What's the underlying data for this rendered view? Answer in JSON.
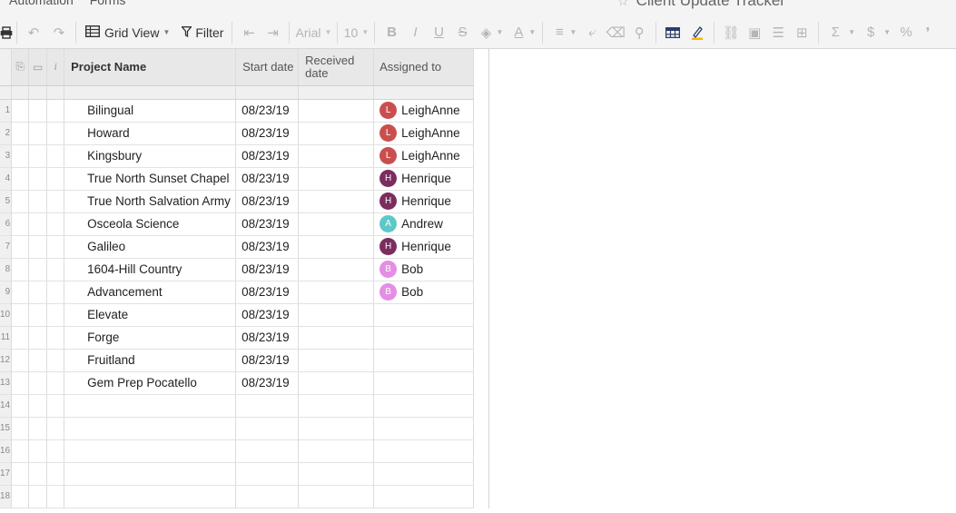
{
  "menu": {
    "items": [
      "Automation",
      "Forms"
    ]
  },
  "document": {
    "title": "Client Update Tracker"
  },
  "toolbar": {
    "view_label": "Grid View",
    "filter_label": "Filter",
    "font_family": "Arial",
    "font_size": "10",
    "colors": {
      "highlight_accent": "#f5b700",
      "text_color_underline": "#cccccc"
    }
  },
  "sheet": {
    "columns": {
      "project_name": "Project Name",
      "start_date": "Start date",
      "received_date": "Received date",
      "assigned_to": "Assigned to"
    },
    "row_numbers": [
      "1",
      "2",
      "3",
      "4",
      "5",
      "6",
      "7",
      "8",
      "9",
      "10",
      "11",
      "12",
      "13",
      "14",
      "15",
      "16",
      "17",
      "18"
    ],
    "rows": [
      {
        "name": "Bilingual",
        "start": "08/23/19",
        "received": "",
        "assignee": "LeighAnne",
        "initial": "L",
        "color": "#c94f4f"
      },
      {
        "name": "Howard",
        "start": "08/23/19",
        "received": "",
        "assignee": "LeighAnne",
        "initial": "L",
        "color": "#c94f4f"
      },
      {
        "name": "Kingsbury",
        "start": "08/23/19",
        "received": "",
        "assignee": "LeighAnne",
        "initial": "L",
        "color": "#c94f4f"
      },
      {
        "name": "True North Sunset Chapel",
        "start": "08/23/19",
        "received": "",
        "assignee": "Henrique",
        "initial": "H",
        "color": "#7b2d5e"
      },
      {
        "name": "True North Salvation Army",
        "start": "08/23/19",
        "received": "",
        "assignee": "Henrique",
        "initial": "H",
        "color": "#7b2d5e"
      },
      {
        "name": "Osceola Science",
        "start": "08/23/19",
        "received": "",
        "assignee": "Andrew",
        "initial": "A",
        "color": "#5ec8c8"
      },
      {
        "name": "Galileo",
        "start": "08/23/19",
        "received": "",
        "assignee": "Henrique",
        "initial": "H",
        "color": "#7b2d5e"
      },
      {
        "name": "1604-Hill Country",
        "start": "08/23/19",
        "received": "",
        "assignee": "Bob",
        "initial": "B",
        "color": "#e48ee4"
      },
      {
        "name": "Advancement",
        "start": "08/23/19",
        "received": "",
        "assignee": "Bob",
        "initial": "B",
        "color": "#e48ee4"
      },
      {
        "name": "Elevate",
        "start": "08/23/19",
        "received": "",
        "assignee": "",
        "initial": "",
        "color": ""
      },
      {
        "name": "Forge",
        "start": "08/23/19",
        "received": "",
        "assignee": "",
        "initial": "",
        "color": ""
      },
      {
        "name": "Fruitland",
        "start": "08/23/19",
        "received": "",
        "assignee": "",
        "initial": "",
        "color": ""
      },
      {
        "name": "Gem Prep Pocatello",
        "start": "08/23/19",
        "received": "",
        "assignee": "",
        "initial": "",
        "color": ""
      },
      {
        "name": "",
        "start": "",
        "received": "",
        "assignee": "",
        "initial": "",
        "color": ""
      },
      {
        "name": "",
        "start": "",
        "received": "",
        "assignee": "",
        "initial": "",
        "color": ""
      },
      {
        "name": "",
        "start": "",
        "received": "",
        "assignee": "",
        "initial": "",
        "color": ""
      },
      {
        "name": "",
        "start": "",
        "received": "",
        "assignee": "",
        "initial": "",
        "color": ""
      },
      {
        "name": "",
        "start": "",
        "received": "",
        "assignee": "",
        "initial": "",
        "color": ""
      }
    ]
  }
}
